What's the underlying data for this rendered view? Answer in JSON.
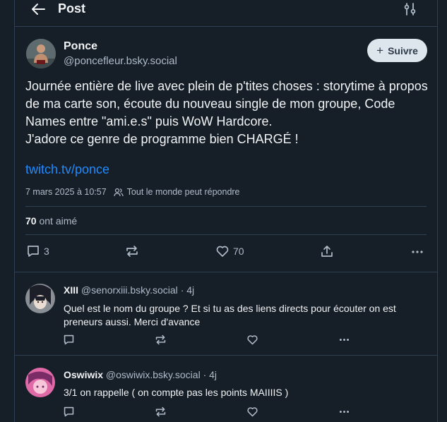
{
  "header": {
    "title": "Post",
    "back_icon": "arrow-left-icon",
    "filter_icon": "sliders-icon"
  },
  "post": {
    "author_name": "Ponce",
    "author_handle": "@poncefleur.bsky.social",
    "follow_label": "Suivre",
    "text": "Journée entière de live avec plein de p'tites choses : storytime à propos de ma carte son, écoute du nouveau single de mon groupe, Code Names entre \"ami.e.s\" puis WoW Hardcore.\nJ'adore ce genre de programme bien CHARGÉ !",
    "link": "twitch.tv/ponce",
    "timestamp": "7 mars 2025 à 10:57",
    "reply_permission": "Tout le monde peut répondre",
    "likes_count": "70",
    "likes_label": "ont aimé",
    "actions": {
      "reply_count": "3",
      "like_count": "70"
    }
  },
  "replies": [
    {
      "name": "XIII",
      "handle": "@senorxiii.bsky.social",
      "age": "· 4j",
      "text": "Quel est le nom du groupe ? Et si tu as des liens directs pour écouter on est preneurs aussi. Merci d'avance"
    },
    {
      "name": "Oswiwix",
      "handle": "@oswiwix.bsky.social",
      "age": "· 4j",
      "text": "3/1 on rappelle ( on compte pas les points MAIIIIS )"
    }
  ],
  "colors": {
    "background": "#161e27",
    "border": "#2e4052",
    "text_primary": "#f1f3f5",
    "text_secondary": "#aebbc9",
    "link": "#208bfe",
    "follow_bg": "#dde5ed"
  }
}
